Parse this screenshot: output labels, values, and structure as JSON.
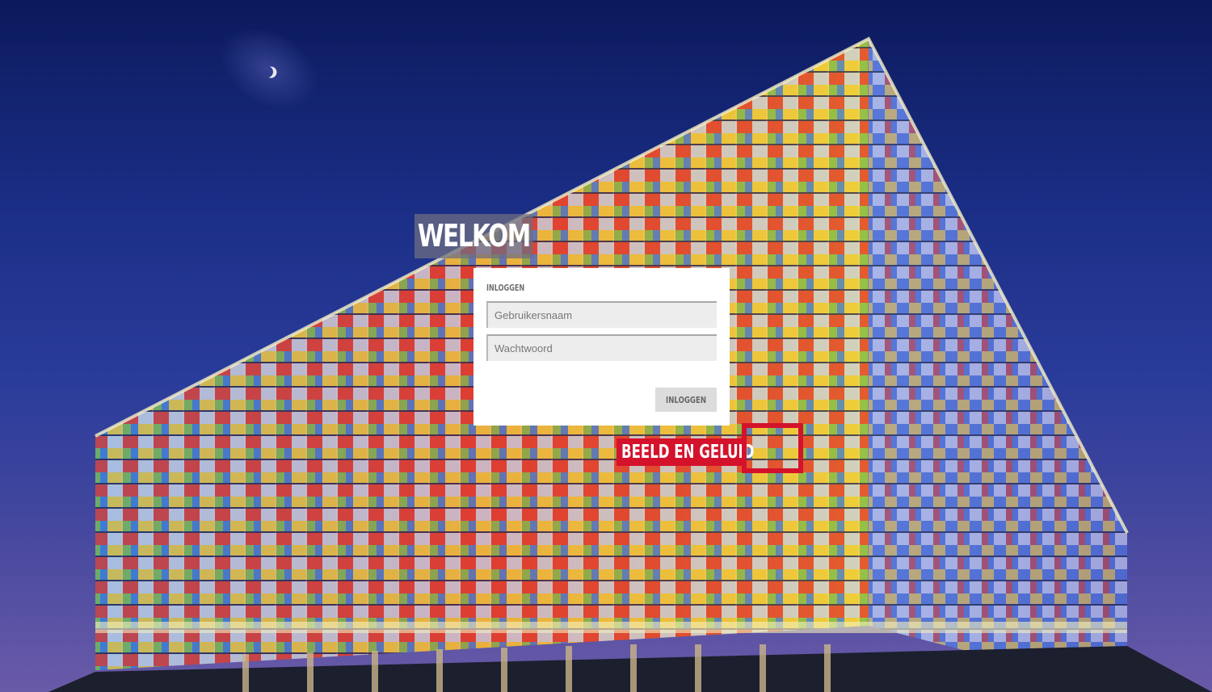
{
  "heading": {
    "title": "WELKOM"
  },
  "login": {
    "section_title": "INLOGGEN",
    "username_placeholder": "Gebruikersnaam",
    "username_value": "",
    "password_placeholder": "Wachtwoord",
    "password_value": "",
    "submit_label": "INLOGGEN"
  },
  "logo": {
    "text": "BEELD EN GELUID",
    "color": "#d4122c"
  },
  "background": {
    "description_icon": "building-photo",
    "sky_color": "#1b2e86"
  }
}
